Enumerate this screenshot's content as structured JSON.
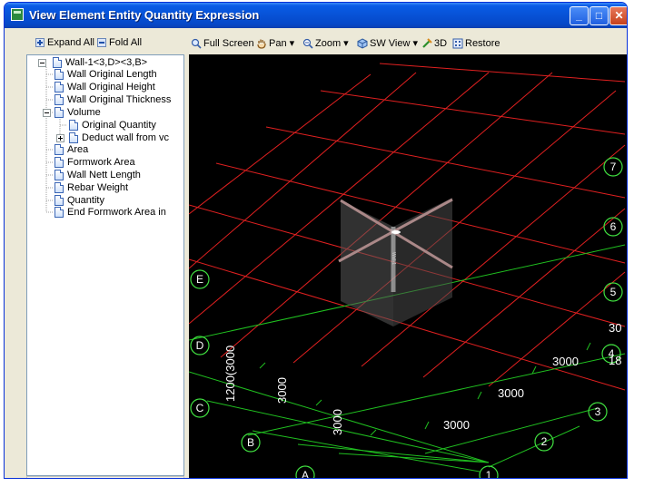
{
  "window": {
    "title": "View Element Entity Quantity Expression",
    "controls": {
      "minimize": "_",
      "maximize": "□",
      "close": "✕"
    }
  },
  "left_toolbar": {
    "expand_all": "Expand All",
    "fold_all": "Fold All"
  },
  "tree": {
    "root": "Wall-1<3,D><3,B>",
    "items": [
      "Wall Original Length",
      "Wall Original Height",
      "Wall Original Thickness",
      "Volume",
      "Original Quantity",
      "Deduct wall from vc",
      "Area",
      "Formwork Area",
      "Wall Nett Length",
      "Rebar Weight",
      "Quantity",
      "End Formwork Area in"
    ]
  },
  "view_toolbar": {
    "full_screen": "Full Screen",
    "pan": "Pan",
    "zoom": "Zoom",
    "sw_view": "SW View",
    "three_d": "3D",
    "restore": "Restore"
  },
  "viewport": {
    "background": "#000000",
    "grid_red": "#e02020",
    "grid_green": "#20c020",
    "axis_labels": [
      "7",
      "6",
      "5",
      "4",
      "3",
      "2",
      "1",
      "E",
      "D",
      "C",
      "B",
      "A"
    ],
    "dimension_labels": [
      "3000",
      "3000",
      "3000",
      "3000",
      "3000",
      "1200(3000",
      "30",
      "18"
    ],
    "element_tag": "Wall-1"
  }
}
